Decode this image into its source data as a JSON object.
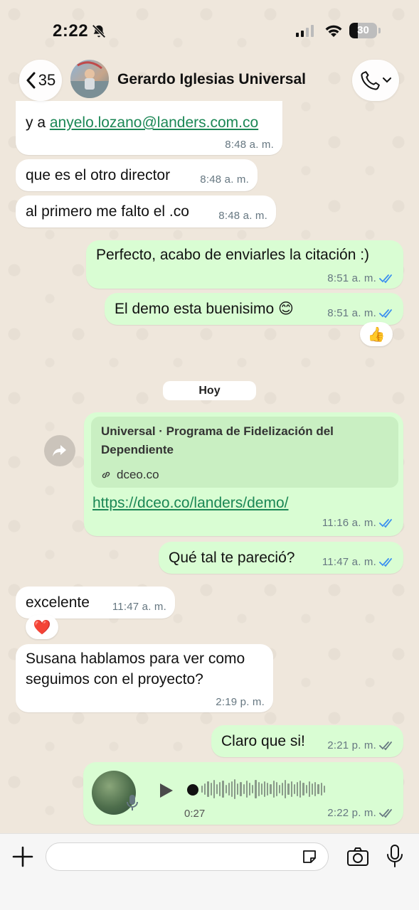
{
  "status_bar": {
    "time": "2:22",
    "battery": "30",
    "battery_level": 0.3
  },
  "header": {
    "back_count": "35",
    "contact_name": "Gerardo Iglesias Universal"
  },
  "messages": [
    {
      "id": "m1",
      "dir": "in",
      "prefix": "y a ",
      "link": "anyelo.lozano@landers.com.co",
      "time": "8:48 a. m."
    },
    {
      "id": "m2",
      "dir": "in",
      "text": "que es el otro director",
      "time": "8:48 a. m."
    },
    {
      "id": "m3",
      "dir": "in",
      "text": "al primero me falto el .co",
      "time": "8:48 a. m."
    },
    {
      "id": "m4",
      "dir": "out",
      "text": "Perfecto, acabo de enviarles la citación :)",
      "time": "8:51 a. m.",
      "status": "read"
    },
    {
      "id": "m5",
      "dir": "out",
      "text": "El demo esta buenisimo 😊",
      "time": "8:51 a. m.",
      "status": "read",
      "reaction": "👍"
    },
    {
      "id": "m6",
      "dir": "out",
      "preview_title": "Universal · Programa de Fidelización del Dependiente",
      "preview_domain": "dceo.co",
      "link": "https://dceo.co/landers/demo/",
      "time": "11:16 a. m.",
      "status": "read"
    },
    {
      "id": "m7",
      "dir": "out",
      "text": "Qué tal te pareció?",
      "time": "11:47 a. m.",
      "status": "read"
    },
    {
      "id": "m8",
      "dir": "in",
      "text": "excelente",
      "time": "11:47 a. m.",
      "reaction": "❤️"
    },
    {
      "id": "m9",
      "dir": "in",
      "text": "Susana hablamos para ver como seguimos con el proyecto?",
      "time": "2:19 p. m."
    },
    {
      "id": "m10",
      "dir": "out",
      "text": "Claro que si!",
      "time": "2:21 p. m.",
      "status": "delivered"
    },
    {
      "id": "m11",
      "dir": "out",
      "voice_duration": "0:27",
      "time": "2:22 p. m.",
      "status": "delivered"
    }
  ],
  "day_separator": "Hoy",
  "colors": {
    "out_bubble": "#d9fdd3",
    "in_bubble": "#ffffff",
    "read_ticks": "#3a8ef0",
    "link": "#1b8755"
  },
  "icons": [
    "bell-off-icon",
    "signal-icon",
    "wifi-icon",
    "battery-icon",
    "back-chevron-icon",
    "phone-icon",
    "chevron-down-icon",
    "double-check-icon",
    "forward-icon",
    "link-icon",
    "play-icon",
    "mic-icon",
    "plus-icon",
    "sticker-icon",
    "camera-icon"
  ]
}
